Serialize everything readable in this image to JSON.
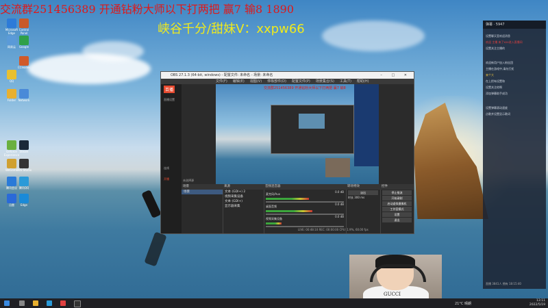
{
  "overlay": {
    "line1": "交流群251456389 开通钻粉大师以下打两把 赢7 输8 1890",
    "line2": "峡谷千分/甜妹V：xxpw66"
  },
  "desktop_icons": [
    {
      "label": "Microsoft Edge",
      "color": "#2d7bd8"
    },
    {
      "label": "Control Panel",
      "color": "#c85a2a"
    },
    {
      "label": "网易云",
      "color": "#5a9ad8"
    },
    {
      "label": "Google",
      "color": "#2fa04a"
    },
    {
      "label": "QQ",
      "color": "#e8c030"
    },
    {
      "label": "CCleaner",
      "color": "#d05a2a"
    },
    {
      "label": "Folder",
      "color": "#e8b030"
    },
    {
      "label": "Network",
      "color": "#4a8ad8"
    },
    {
      "label": "Geforce Experience",
      "color": "#6ab040"
    },
    {
      "label": "Steam",
      "color": "#1b2838"
    },
    {
      "label": "WeGame",
      "color": "#d0a030"
    },
    {
      "label": "OBS Studio",
      "color": "#333333"
    },
    {
      "label": "腾讯会议",
      "color": "#2a7ad8"
    },
    {
      "label": "腾讯QQ",
      "color": "#2a9ad8"
    },
    {
      "label": "迅雷",
      "color": "#2a6ad8"
    },
    {
      "label": "Edge",
      "color": "#1a8ad8"
    }
  ],
  "obs": {
    "title": "OBS 27.1.3 (64-bit, windows) - 配置文件: 未命名 - 场景: 未命名",
    "menu": [
      "文件(F)",
      "编辑(E)",
      "视图(V)",
      "停靠部件(D)",
      "配置文件(P)",
      "场景集合(S)",
      "工具(T)",
      "帮助(H)"
    ],
    "preview_title": "交流群251456389 开通钻粉大师以下打两把 赢7 输8",
    "scenes_header": "场景",
    "scenes": [
      "场景"
    ],
    "sources_header": "来源",
    "sources": [
      "文本 (GDI+) 2",
      "视频采集设备",
      "文本 (GDI+)",
      "显示器采集"
    ],
    "mixer_header": "音频混音器",
    "mixer": [
      {
        "name": "麦克风/Aux",
        "level": "0.0 dB",
        "fill": 0.55
      },
      {
        "name": "桌面音频",
        "level": "0.0 dB",
        "fill": 0.6
      },
      {
        "name": "视频采集设备",
        "level": "0.0 dB",
        "fill": 0.2
      }
    ],
    "transitions_header": "转场特效",
    "transition_value": "淡出",
    "duration_label": "时长",
    "duration_value": "300 ms",
    "controls_header": "控件",
    "controls": [
      "停止推流",
      "开始录制",
      "启动虚拟摄像机",
      "工作室模式",
      "设置",
      "退出"
    ],
    "status": "LIVE: 00:48:10   REC: 00:00:00   CPU: 1.9%, 60.00 fps",
    "side_logo": "百播",
    "side_items": [
      "直播设置",
      "连线",
      "开播"
    ],
    "no_source_text": "未选择源"
  },
  "right_panel": {
    "header": "弹幕",
    "header_count": "5947",
    "messages": [
      {
        "text": "设置聊天室欢迎消息",
        "cls": ""
      },
      {
        "text": "欢迎 主播 来了xxx进入直播间",
        "cls": "r"
      },
      {
        "text": "设置关注主播的",
        "cls": ""
      },
      {
        "text": "欢迎新用户加入粉丝团",
        "cls": ""
      },
      {
        "text": "主播在游戏中,请勿打扰",
        "cls": ""
      },
      {
        "text": "来个大",
        "cls": "y"
      },
      {
        "text": "在上把有设置和",
        "cls": ""
      },
      {
        "text": "设置关注他啊",
        "cls": ""
      },
      {
        "text": "添加弹幕助手成功",
        "cls": ""
      },
      {
        "text": "设置弹幕滚动速度",
        "cls": ""
      },
      {
        "text": "点歌并设置显示歌词",
        "cls": ""
      }
    ],
    "footer": "直播 3841人  拥有 18:15:40"
  },
  "taskbar": {
    "weather": "21°C 晴朗",
    "time": "13:11",
    "date": "2022/5/19"
  }
}
